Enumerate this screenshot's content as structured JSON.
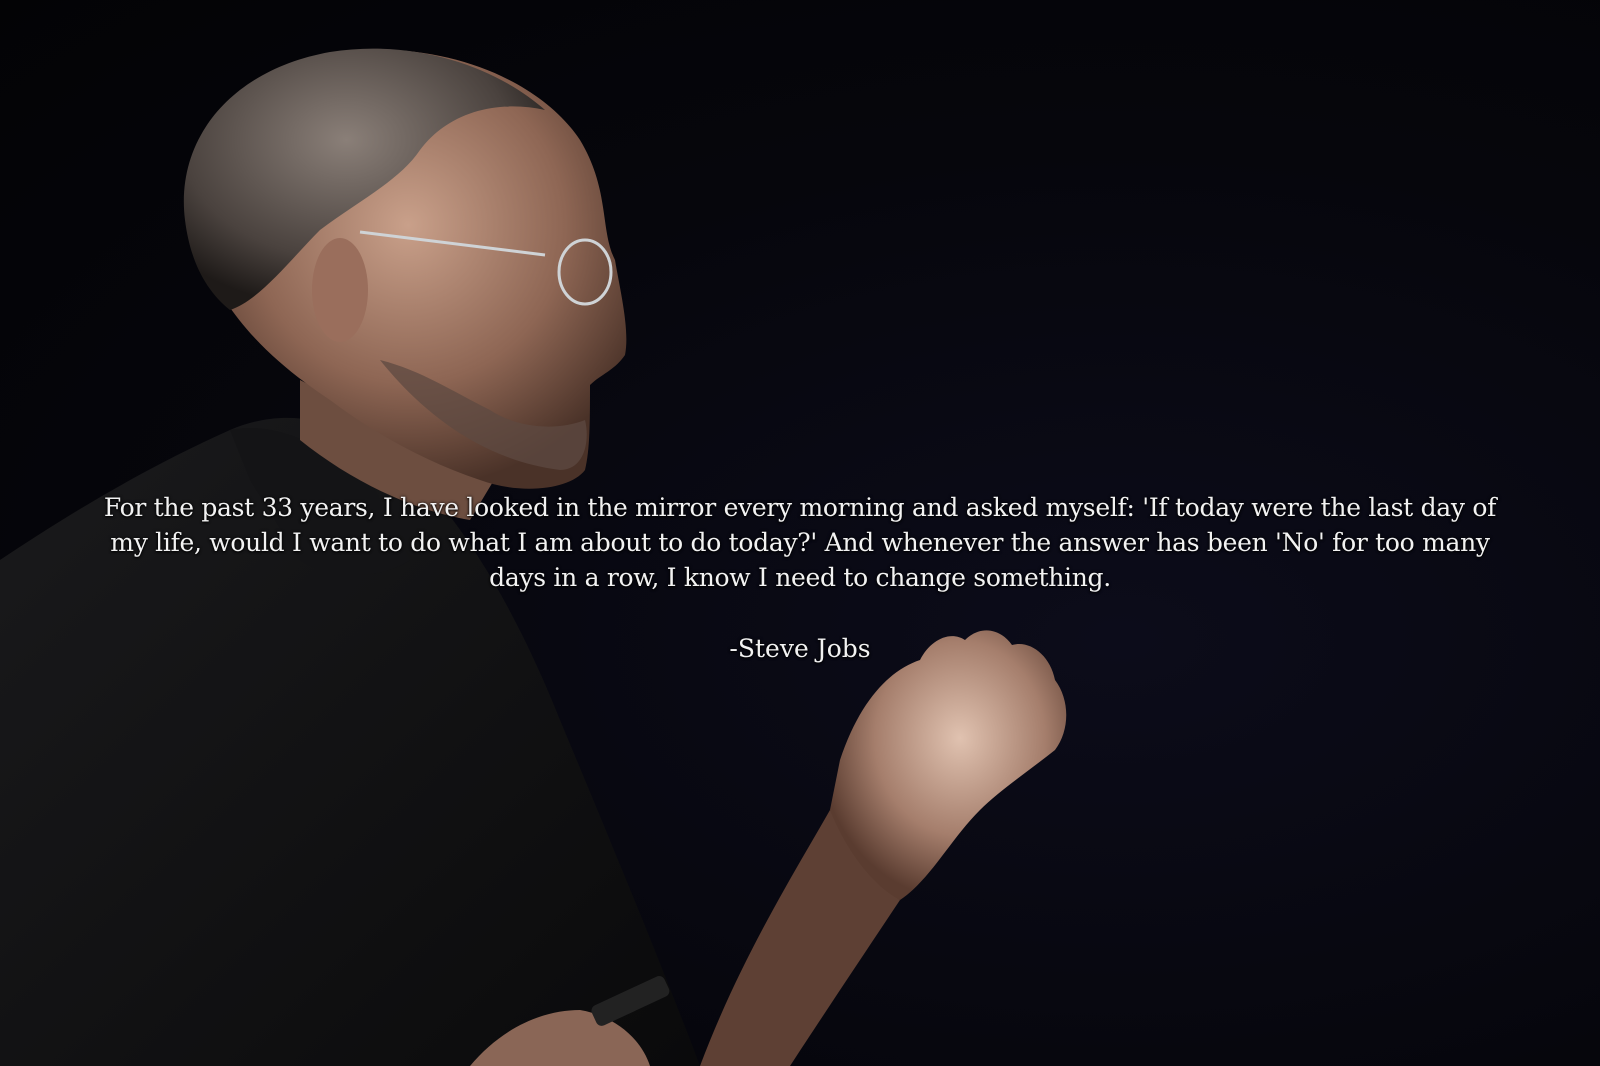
{
  "quote": {
    "text": "For the past 33 years, I have looked in the mirror every morning and asked myself: 'If today were the last day of my life, would I want to do what I am about to do today?' And whenever the answer has been 'No' for too many days in a row, I know I need to change something.",
    "attribution": "-Steve Jobs"
  },
  "colors": {
    "background": "#050508",
    "text": "#f2f2f2"
  }
}
